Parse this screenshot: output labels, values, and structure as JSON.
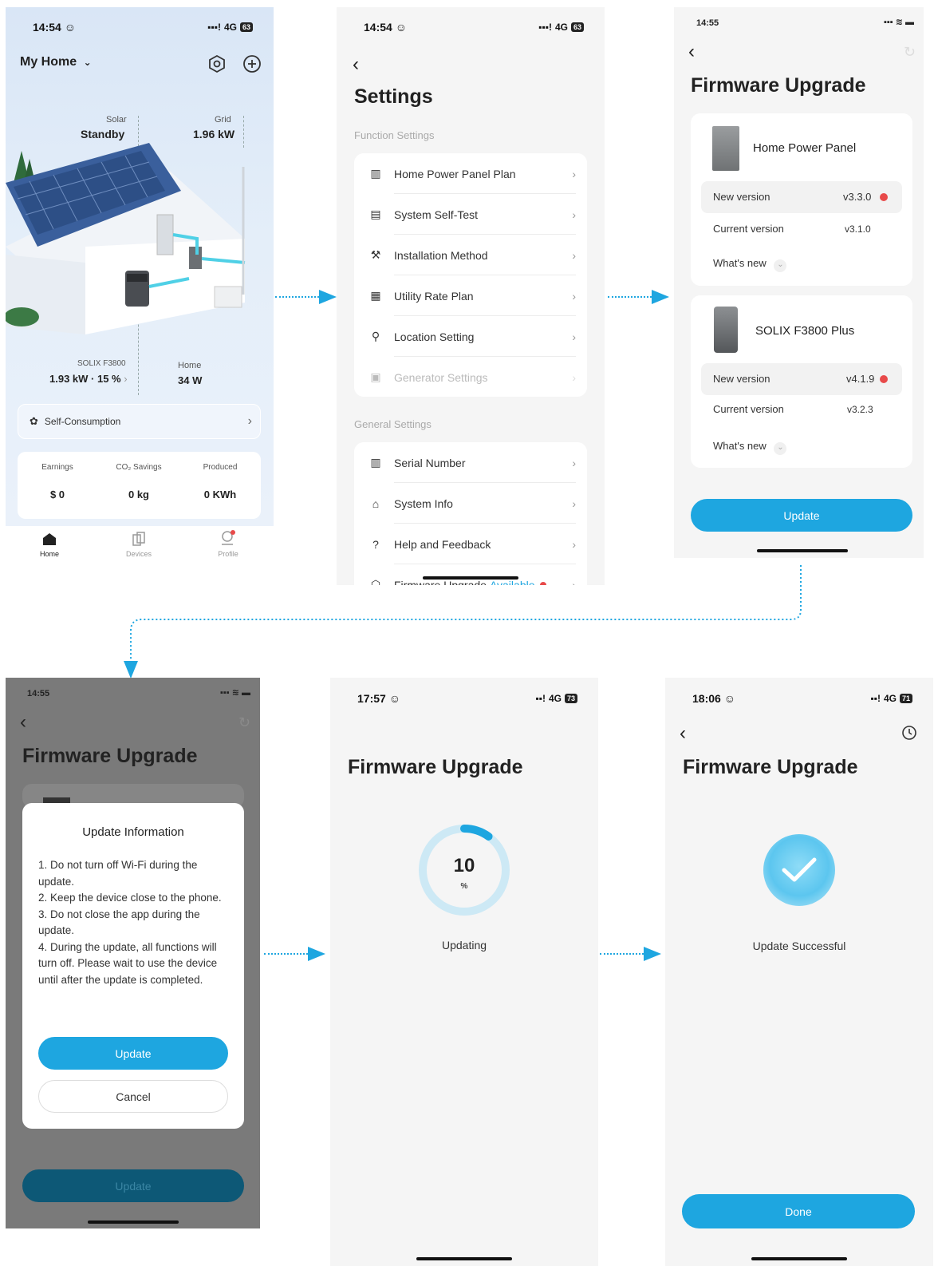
{
  "s1": {
    "time": "14:54 ☺",
    "network": "4G",
    "battery": "63",
    "title": "My Home",
    "solar_label": "Solar",
    "solar_value": "Standby",
    "grid_label": "Grid",
    "grid_value": "1.96 kW",
    "device_label": "SOLIX F3800",
    "device_value": "1.93 kW · 15 %",
    "home_label": "Home",
    "home_value": "34 W",
    "mode": "Self-Consumption",
    "stats": [
      {
        "label": "Earnings",
        "value": "$ 0"
      },
      {
        "label": "CO₂ Savings",
        "value": "0 kg"
      },
      {
        "label": "Produced",
        "value": "0 KWh"
      }
    ],
    "tabs": [
      "Home",
      "Devices",
      "Profile"
    ]
  },
  "s2": {
    "time": "14:54 ☺",
    "network": "4G",
    "battery": "63",
    "title": "Settings",
    "section1": "Function Settings",
    "section2": "General Settings",
    "function_items": [
      "Home Power Panel Plan",
      "System Self-Test",
      "Installation Method",
      "Utility Rate Plan",
      "Location Setting",
      "Generator Settings"
    ],
    "general_items": [
      "Serial Number",
      "System Info",
      "Help and Feedback"
    ],
    "fw_label": "Firmware Upgrade",
    "fw_status": "Available"
  },
  "s3": {
    "time": "14:55",
    "title": "Firmware Upgrade",
    "devices": [
      {
        "name": "Home Power Panel",
        "new_label": "New version",
        "new_value": "v3.3.0",
        "cur_label": "Current version",
        "cur_value": "v3.1.0",
        "whats_new": "What's new"
      },
      {
        "name": "SOLIX F3800 Plus",
        "new_label": "New version",
        "new_value": "v4.1.9",
        "cur_label": "Current version",
        "cur_value": "v3.2.3",
        "whats_new": "What's new"
      }
    ],
    "update": "Update"
  },
  "s4": {
    "time": "14:55",
    "title": "Firmware Upgrade",
    "dialog_title": "Update Information",
    "dialog_text": [
      "1. Do not turn off Wi-Fi during the update.",
      "2. Keep the device close to the phone.",
      "3. Do not close the app during the update.",
      "4. During the update, all functions will turn off. Please wait to use the device until after the update is completed."
    ],
    "update": "Update",
    "cancel": "Cancel",
    "bg_update": "Update"
  },
  "s5": {
    "time": "17:57 ☺",
    "network": "4G",
    "battery": "73",
    "title": "Firmware Upgrade",
    "progress": 10,
    "progress_text": "10",
    "unit": "%",
    "status": "Updating"
  },
  "s6": {
    "time": "18:06 ☺",
    "network": "4G",
    "battery": "71",
    "title": "Firmware Upgrade",
    "status": "Update Successful",
    "done": "Done"
  },
  "colors": {
    "accent": "#1ea6e0",
    "dot_red": "#e84a4a"
  }
}
